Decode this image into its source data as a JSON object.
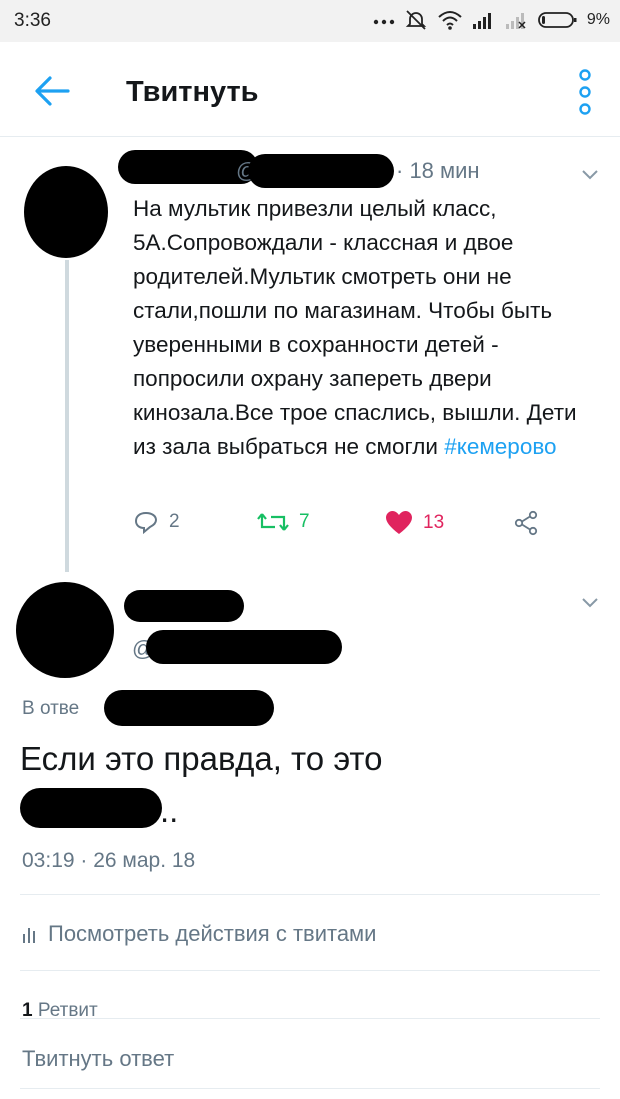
{
  "status_bar": {
    "time": "3:36",
    "battery": "9%",
    "icons": [
      "dots-icon",
      "mute-icon",
      "wifi-icon",
      "signal-icon",
      "signal-none-icon",
      "battery-icon"
    ]
  },
  "header": {
    "title": "Твитнуть",
    "back_icon": "arrow-left-icon",
    "menu_icon": "more-vertical-icon",
    "accent_color": "#1da1f2"
  },
  "tweet_parent": {
    "handle_prefix": "@",
    "time_ago": "· 18 мин",
    "text": "На мультик привезли целый класс, 5А.Сопровождали - классная и двое родителей.Мультик смотреть они не стали,пошли по магазинам. Чтобы быть уверенными в сохранности детей - попросили охрану запереть двери кинозала.Все трое спаслись, вышли. Дети из зала выбраться не смогли ",
    "hashtag": "#кемерово",
    "replies": "2",
    "retweets": "7",
    "likes": "13",
    "colors": {
      "retweet": "#17bf63",
      "like": "#e0245e"
    }
  },
  "tweet_main": {
    "handle_prefix": "@",
    "reply_prefix": "В отве",
    "text": "Если это правда, то это",
    "text_tail": "..",
    "timestamp": "03:19 · 26 мар. 18",
    "activity_label": "Посмотреть действия с твитами",
    "retweet_count": "1",
    "retweet_label": " Ретвит",
    "reply_placeholder": "Твитнуть ответ"
  }
}
